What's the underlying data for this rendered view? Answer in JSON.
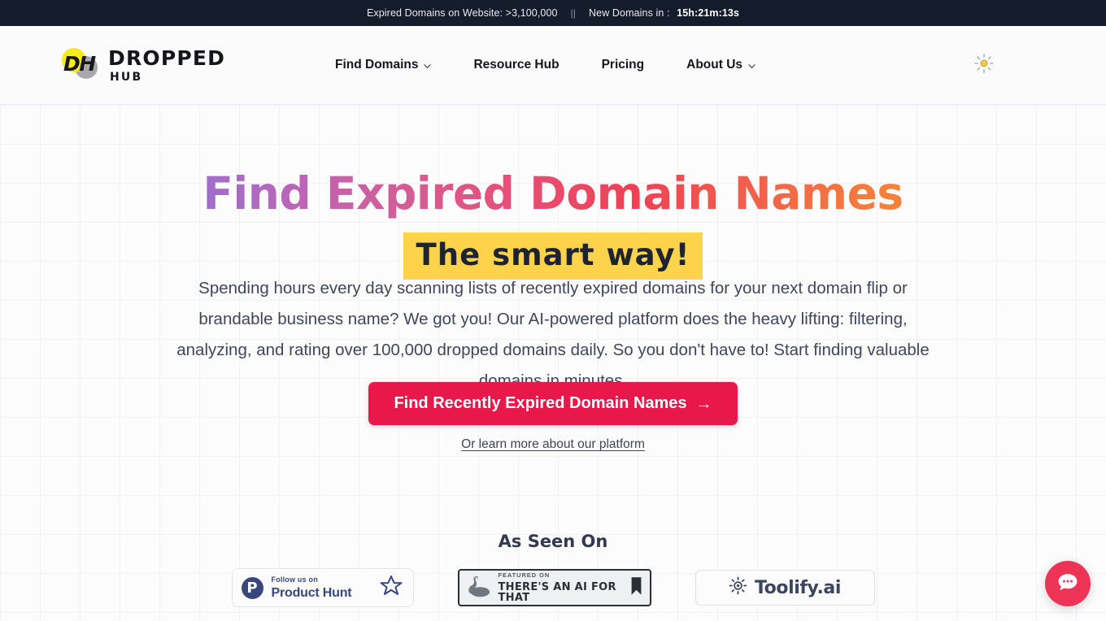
{
  "topbar": {
    "expired_text": "Expired Domains on Website: >3,100,000",
    "separator": "||",
    "countdown_label": "New Domains in :",
    "countdown_value": "15h:21m:13s"
  },
  "header": {
    "logo": {
      "mark_text": "DH",
      "word_top": "DROPPED",
      "word_bottom": "HUB"
    },
    "nav": [
      {
        "label": "Find Domains",
        "has_chevron": true
      },
      {
        "label": "Resource Hub",
        "has_chevron": false
      },
      {
        "label": "Pricing",
        "has_chevron": false
      },
      {
        "label": "About Us",
        "has_chevron": true
      }
    ],
    "theme_toggle_icon": "sun-icon"
  },
  "hero": {
    "heading": "Find Expired Domain Names",
    "subheading": "The smart way!",
    "paragraph": "Spending hours every day scanning lists of recently expired domains for your next domain flip or brandable business name? We got you! Our AI-powered platform does the heavy lifting: filtering, analyzing, and rating over 100,000 dropped domains daily. So you don't have to! Start finding valuable domains in minutes.",
    "cta_label": "Find Recently Expired Domain Names",
    "cta_arrow": "→",
    "sub_link": "Or learn more about our platform"
  },
  "as_seen_on": {
    "title": "As Seen On",
    "badges": {
      "product_hunt": {
        "mark": "P",
        "line1": "Follow us on",
        "line2": "Product Hunt",
        "right_icon": "star-icon"
      },
      "theres_an_ai_for_that": {
        "line1": "FEATURED ON",
        "line2": "THERE'S AN AI FOR THAT",
        "left_icon": "seal-mascot-icon",
        "right_icon": "bookmark-icon"
      },
      "toolify": {
        "label": "Toolify.ai",
        "left_icon": "gear-icon"
      }
    }
  },
  "chat_widget": {
    "icon": "chat-bubble-icon"
  },
  "colors": {
    "topbar_bg": "#151c2c",
    "accent_red": "#e8194a",
    "highlight_yellow": "#fcd34b",
    "gradient_start": "#7b79e6",
    "gradient_end": "#f5a21f",
    "navy": "#39477f",
    "chat_fab": "#ed3457",
    "logo_yellow": "#f5ea1e"
  }
}
